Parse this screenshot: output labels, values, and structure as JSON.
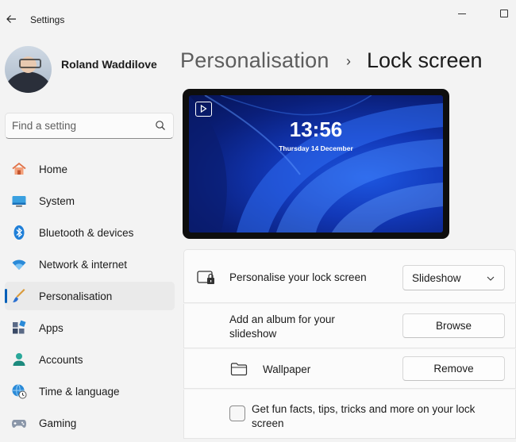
{
  "window": {
    "title": "Settings"
  },
  "user": {
    "name": "Roland Waddilove"
  },
  "search": {
    "placeholder": "Find a setting"
  },
  "nav": {
    "items": [
      {
        "label": "Home",
        "icon": "home-icon"
      },
      {
        "label": "System",
        "icon": "system-icon"
      },
      {
        "label": "Bluetooth & devices",
        "icon": "bluetooth-icon"
      },
      {
        "label": "Network & internet",
        "icon": "wifi-icon"
      },
      {
        "label": "Personalisation",
        "icon": "brush-icon",
        "active": true
      },
      {
        "label": "Apps",
        "icon": "apps-icon"
      },
      {
        "label": "Accounts",
        "icon": "person-icon"
      },
      {
        "label": "Time & language",
        "icon": "globe-clock-icon"
      },
      {
        "label": "Gaming",
        "icon": "gamepad-icon"
      }
    ]
  },
  "breadcrumb": {
    "parent": "Personalisation",
    "separator": "›",
    "current": "Lock screen"
  },
  "preview": {
    "time": "13:56",
    "date": "Thursday 14 December"
  },
  "settings": {
    "personalise": {
      "label": "Personalise your lock screen",
      "selected": "Slideshow"
    },
    "album": {
      "label_line1": "Add an album for your",
      "label_line2": "slideshow",
      "button": "Browse"
    },
    "folder": {
      "label": "Wallpaper",
      "button": "Remove"
    },
    "tips": {
      "label_line1": "Get fun facts, tips, tricks and more on your lock",
      "label_line2": "screen",
      "checked": false
    }
  },
  "colors": {
    "accent": "#005fb8",
    "background": "#f3f3f3",
    "card": "#fbfbfb"
  }
}
